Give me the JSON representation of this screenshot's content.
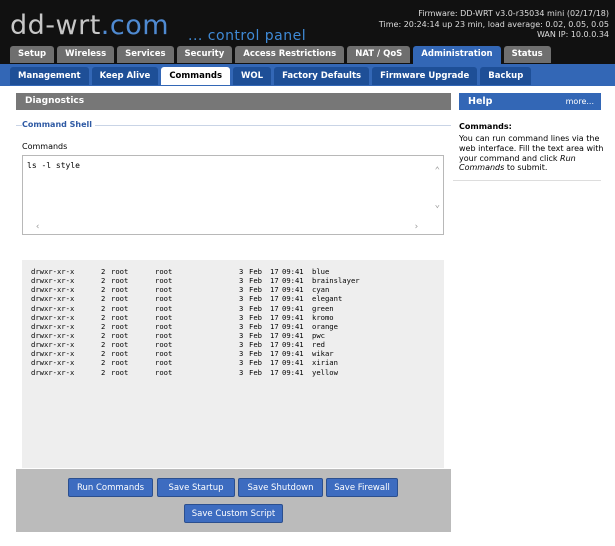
{
  "brand": {
    "logo_main": "dd-wrt",
    "logo_dot": ".com",
    "logo_sub": "... control panel"
  },
  "status": {
    "firmware": "Firmware: DD-WRT v3.0-r35034 mini (02/17/18)",
    "time": "Time: 20:24:14 up 23 min, load average: 0.02, 0.05, 0.05",
    "wan_ip": "WAN IP: 10.0.0.34"
  },
  "main_tabs": [
    "Setup",
    "Wireless",
    "Services",
    "Security",
    "Access Restrictions",
    "NAT / QoS",
    "Administration",
    "Status"
  ],
  "sub_tabs": [
    "Management",
    "Keep Alive",
    "Commands",
    "WOL",
    "Factory Defaults",
    "Firmware Upgrade",
    "Backup"
  ],
  "section": {
    "title": "Diagnostics",
    "legend": "Command Shell",
    "commands_label": "Commands",
    "commands_value": "ls -l style"
  },
  "output_rows": [
    [
      "drwxr-xr-x",
      "2",
      "root",
      "root",
      "3",
      "Feb",
      "17",
      "09:41",
      "blue"
    ],
    [
      "drwxr-xr-x",
      "2",
      "root",
      "root",
      "3",
      "Feb",
      "17",
      "09:41",
      "brainslayer"
    ],
    [
      "drwxr-xr-x",
      "2",
      "root",
      "root",
      "3",
      "Feb",
      "17",
      "09:41",
      "cyan"
    ],
    [
      "drwxr-xr-x",
      "2",
      "root",
      "root",
      "3",
      "Feb",
      "17",
      "09:41",
      "elegant"
    ],
    [
      "drwxr-xr-x",
      "2",
      "root",
      "root",
      "3",
      "Feb",
      "17",
      "09:41",
      "green"
    ],
    [
      "drwxr-xr-x",
      "2",
      "root",
      "root",
      "3",
      "Feb",
      "17",
      "09:41",
      "kromo"
    ],
    [
      "drwxr-xr-x",
      "2",
      "root",
      "root",
      "3",
      "Feb",
      "17",
      "09:41",
      "orange"
    ],
    [
      "drwxr-xr-x",
      "2",
      "root",
      "root",
      "3",
      "Feb",
      "17",
      "09:41",
      "pwc"
    ],
    [
      "drwxr-xr-x",
      "2",
      "root",
      "root",
      "3",
      "Feb",
      "17",
      "09:41",
      "red"
    ],
    [
      "drwxr-xr-x",
      "2",
      "root",
      "root",
      "3",
      "Feb",
      "17",
      "09:41",
      "wikar"
    ],
    [
      "drwxr-xr-x",
      "2",
      "root",
      "root",
      "3",
      "Feb",
      "17",
      "09:41",
      "xirian"
    ],
    [
      "drwxr-xr-x",
      "2",
      "root",
      "root",
      "3",
      "Feb",
      "17",
      "09:41",
      "yellow"
    ]
  ],
  "buttons": {
    "run": "Run Commands",
    "startup": "Save Startup",
    "shutdown": "Save Shutdown",
    "firewall": "Save Firewall",
    "custom": "Save Custom Script"
  },
  "help": {
    "title": "Help",
    "more": "more...",
    "heading": "Commands:",
    "body_pre": "You can run command lines via the web interface. Fill the text area with your command and click ",
    "body_em": "Run Commands",
    "body_post": " to submit."
  },
  "icons": {
    "scroll_up": "chevron-up-icon",
    "scroll_down": "chevron-down-icon",
    "scroll_left": "chevron-left-icon",
    "scroll_right": "chevron-right-icon"
  },
  "colors": {
    "accent": "#3367b6",
    "header_bg": "#111111",
    "button": "#3d6cc0"
  }
}
